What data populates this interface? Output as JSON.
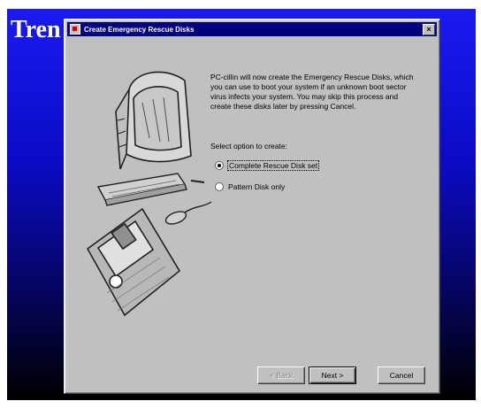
{
  "background": {
    "title": "Tren",
    "gradient_top": "#1a1af2",
    "gradient_bottom": "#000000"
  },
  "dialog": {
    "title": "Create Emergency Rescue Disks",
    "close_label": "×",
    "description": "PC-cillin will now create the Emergency Rescue Disks, which you can use to boot your system if an unknown boot sector virus infects your system. You may skip this process and create these disks later by pressing Cancel.",
    "select_label": "Select option to create:",
    "options": [
      {
        "label": "Complete Rescue Disk set",
        "selected": true
      },
      {
        "label": "Pattern Disk only",
        "selected": false
      }
    ],
    "buttons": {
      "back": "< Back",
      "next": "Next >",
      "cancel": "Cancel"
    }
  },
  "icons": {
    "app": "app-icon",
    "illustration": "computer-floppy-illustration"
  },
  "colors": {
    "titlebar": "#000080",
    "dialog": "#c0c0c0"
  }
}
